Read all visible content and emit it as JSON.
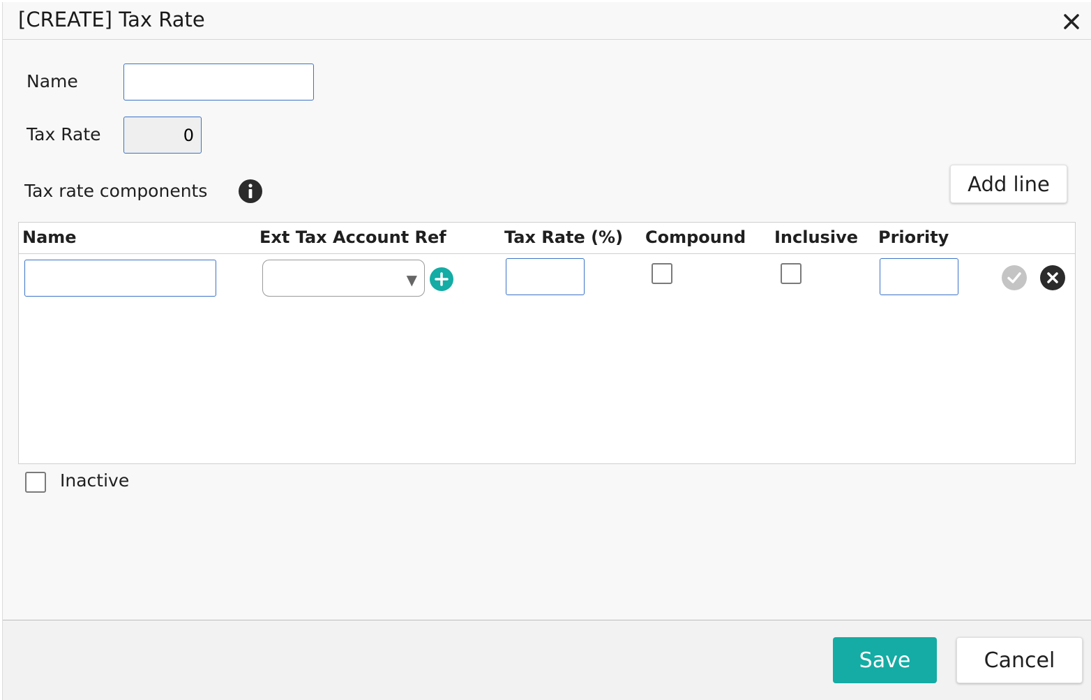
{
  "dialog": {
    "title": "[CREATE] Tax Rate",
    "close_icon": "close-icon"
  },
  "form": {
    "name_label": "Name",
    "name_value": "",
    "tax_rate_label": "Tax Rate",
    "tax_rate_value": "0"
  },
  "components": {
    "section_label": "Tax rate components",
    "info_icon": "info-icon",
    "add_line_label": "Add line",
    "columns": [
      "Name",
      "Ext Tax Account Ref",
      "Tax Rate (%)",
      "Compound",
      "Inclusive",
      "Priority"
    ],
    "rows": [
      {
        "name": "",
        "ext_tax_account_ref": "",
        "tax_rate": "",
        "compound": false,
        "inclusive": false,
        "priority": ""
      }
    ]
  },
  "inactive": {
    "label": "Inactive",
    "checked": false
  },
  "footer": {
    "save_label": "Save",
    "cancel_label": "Cancel"
  },
  "colors": {
    "accent": "#14aca4",
    "input_border": "#3b73c8"
  }
}
